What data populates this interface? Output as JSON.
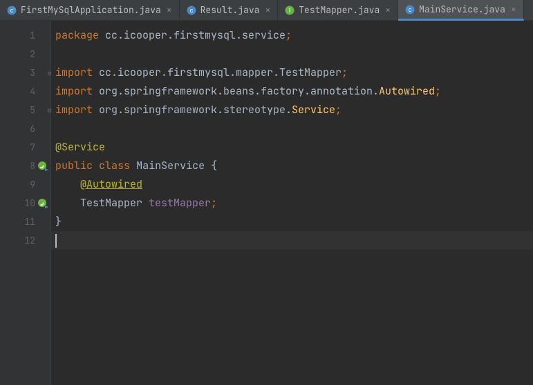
{
  "tabs": [
    {
      "label": "FirstMySqlApplication.java",
      "icon": "class-run",
      "active": false
    },
    {
      "label": "Result.java",
      "icon": "class",
      "active": false
    },
    {
      "label": "TestMapper.java",
      "icon": "interface",
      "active": false
    },
    {
      "label": "MainService.java",
      "icon": "class",
      "active": true
    }
  ],
  "gutter": {
    "lines": [
      "1",
      "2",
      "3",
      "4",
      "5",
      "6",
      "7",
      "8",
      "9",
      "10",
      "11",
      "12"
    ],
    "spring_icon_lines": [
      8,
      10
    ],
    "fold_lines": [
      3,
      5
    ]
  },
  "code": {
    "l1": {
      "kw": "package",
      "rest": " cc.icooper.firstmysql.service",
      "semi": ";"
    },
    "l3": {
      "kw": "import",
      "rest": " cc.icooper.firstmysql.mapper.TestMapper",
      "semi": ";"
    },
    "l4": {
      "kw": "import",
      "rest": " org.springframework.beans.factory.annotation.",
      "tail": "Autowired",
      "semi": ";"
    },
    "l5": {
      "kw": "import",
      "rest": " org.springframework.stereotype.",
      "tail": "Service",
      "semi": ";"
    },
    "l7": {
      "ann": "@Service"
    },
    "l8": {
      "kw1": "public",
      "kw2": "class",
      "name": "MainService",
      "brace": "{"
    },
    "l9": {
      "indent": "    ",
      "annU": "@Autowired"
    },
    "l10": {
      "indent": "    ",
      "type": "TestMapper",
      "field": "testMapper",
      "semi": ";"
    },
    "l11": {
      "brace": "}"
    }
  },
  "colors": {
    "background": "#2b2b2b",
    "gutter": "#313335",
    "tabbar": "#3c3f41",
    "active_tab_underline": "#4a88c7",
    "keyword": "#cc7832",
    "annotation": "#bbb529",
    "identifier_highlight": "#ffc66d",
    "field": "#9876aa",
    "text": "#a9b7c6",
    "line_number": "#606366"
  },
  "current_line": 12
}
